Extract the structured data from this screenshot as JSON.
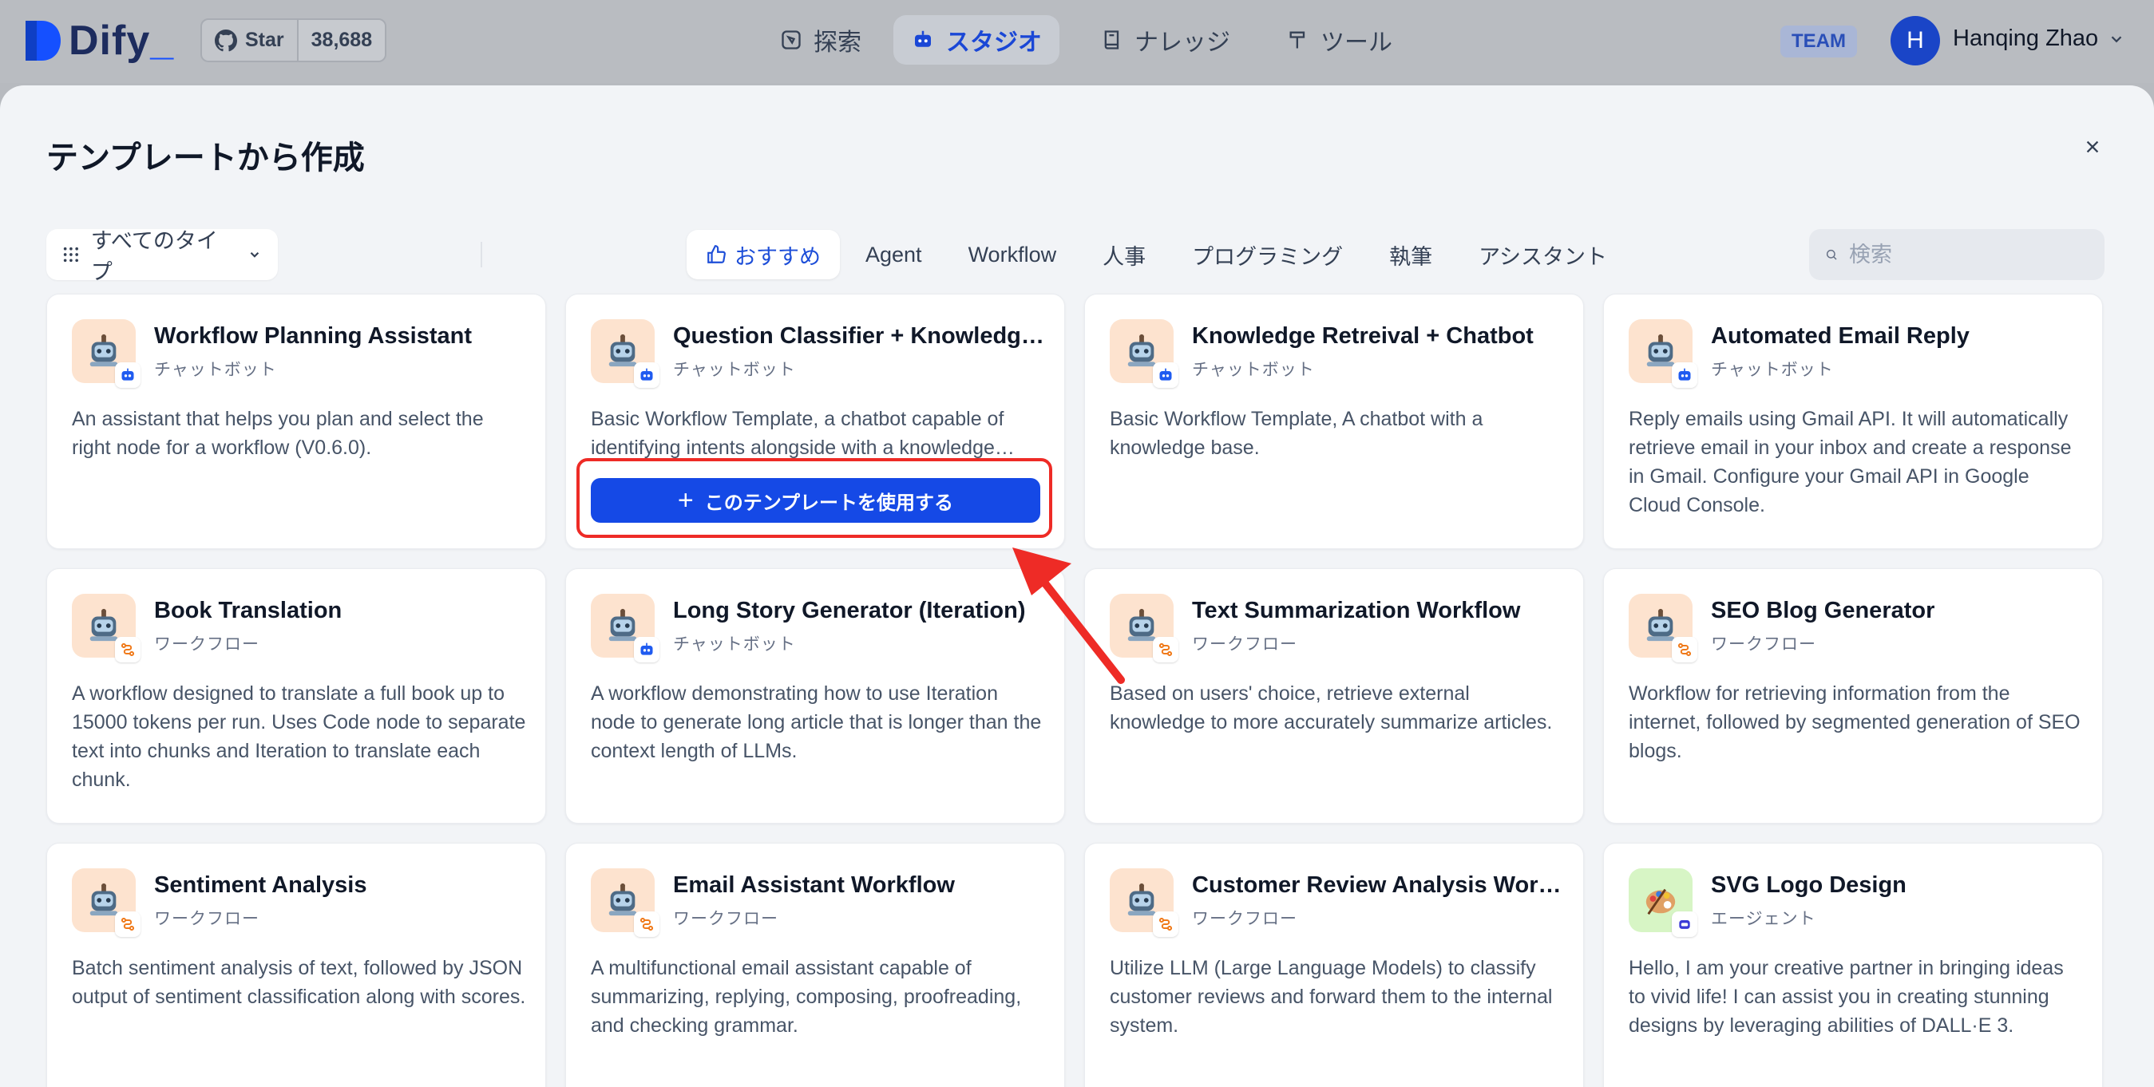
{
  "app": {
    "logo_text": "Dify",
    "github": {
      "star_label": "Star",
      "star_count": "38,688"
    },
    "nav": {
      "explore": "探索",
      "studio": "スタジオ",
      "knowledge": "ナレッジ",
      "tools": "ツール"
    },
    "team_badge": "TEAM",
    "user": {
      "initial": "H",
      "name": "Hanqing Zhao"
    }
  },
  "modal": {
    "title": "テンプレートから作成",
    "type_filter": "すべてのタイプ",
    "tabs": [
      "おすすめ",
      "Agent",
      "Workflow",
      "人事",
      "プログラミング",
      "執筆",
      "アシスタント"
    ],
    "search_placeholder": "検索",
    "use_template_label": "このテンプレートを使用する"
  },
  "cards": [
    {
      "title": "Workflow Planning Assistant",
      "type": "チャットボット",
      "desc": "An assistant that helps you plan and select the right node for a workflow (V0.6.0).",
      "icon": "robot-icon",
      "mode": "chatbot-icon"
    },
    {
      "title": "Question Classifier + Knowledge + Chatbot",
      "type": "チャットボット",
      "desc": "Basic Workflow Template, a chatbot capable of identifying intents alongside with a knowledge base.",
      "icon": "robot-icon",
      "mode": "chatbot-icon"
    },
    {
      "title": "Knowledge Retreival + Chatbot",
      "type": "チャットボット",
      "desc": "Basic Workflow Template, A chatbot with a knowledge base.",
      "icon": "robot-icon",
      "mode": "chatbot-icon"
    },
    {
      "title": "Automated Email Reply",
      "type": "チャットボット",
      "desc": "Reply emails using Gmail API. It will automatically retrieve email in your inbox and create a response in Gmail. Configure your Gmail API in Google Cloud Console.",
      "icon": "robot-icon",
      "mode": "chatbot-icon"
    },
    {
      "title": "Book Translation",
      "type": "ワークフロー",
      "desc": "A workflow designed to translate a full book up to 15000 tokens per run. Uses Code node to separate text into chunks and Iteration to translate each chunk.",
      "icon": "robot-icon",
      "mode": "workflow-icon"
    },
    {
      "title": "Long Story Generator (Iteration)",
      "type": "チャットボット",
      "desc": "A workflow demonstrating how to use Iteration node to generate long article that is longer than the context length of LLMs.",
      "icon": "robot-icon",
      "mode": "chatbot-icon"
    },
    {
      "title": "Text Summarization Workflow",
      "type": "ワークフロー",
      "desc": "Based on users' choice, retrieve external knowledge to more accurately summarize articles.",
      "icon": "robot-icon",
      "mode": "workflow-icon"
    },
    {
      "title": "SEO Blog Generator",
      "type": "ワークフロー",
      "desc": "Workflow for retrieving information from the internet, followed by segmented generation of SEO blogs.",
      "icon": "robot-icon",
      "mode": "workflow-icon"
    },
    {
      "title": "Sentiment Analysis",
      "type": "ワークフロー",
      "desc": "Batch sentiment analysis of text, followed by JSON output of sentiment classification along with scores.",
      "icon": "robot-icon",
      "mode": "workflow-icon"
    },
    {
      "title": "Email Assistant Workflow",
      "type": "ワークフロー",
      "desc": "A multifunctional email assistant capable of summarizing, replying, composing, proofreading, and checking grammar.",
      "icon": "robot-icon",
      "mode": "workflow-icon"
    },
    {
      "title": "Customer Review Analysis Workflow",
      "type": "ワークフロー",
      "desc": "Utilize LLM (Large Language Models) to classify customer reviews and forward them to the internal system.",
      "icon": "robot-icon",
      "mode": "workflow-icon"
    },
    {
      "title": "SVG Logo Design",
      "type": "エージェント",
      "desc": "Hello, I am your creative partner in bringing ideas to vivid life! I can assist you in creating stunning designs by leveraging abilities of DALL·E 3.",
      "icon": "palette-icon",
      "mode": "agent-icon"
    }
  ],
  "colors": {
    "accent": "#1549e6",
    "highlight": "#ee2b26",
    "icon_bg": "#fde3cf"
  }
}
